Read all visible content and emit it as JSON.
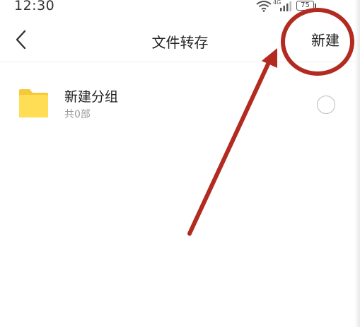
{
  "status_bar": {
    "time": "12:30",
    "signal_label": "4G",
    "battery_level": "75",
    "icons": [
      "wifi-icon",
      "signal-icon",
      "battery-icon"
    ]
  },
  "header": {
    "title": "文件转存",
    "new_label": "新建",
    "back_icon": "chevron-left-icon"
  },
  "folders": [
    {
      "name": "新建分组",
      "count": "共0部",
      "icon": "folder-icon",
      "icon_color": "#FFD84A",
      "selected": false
    }
  ],
  "annotation": {
    "color": "#B22A20",
    "shapes": [
      "circle",
      "arrow"
    ],
    "target": "新建"
  }
}
